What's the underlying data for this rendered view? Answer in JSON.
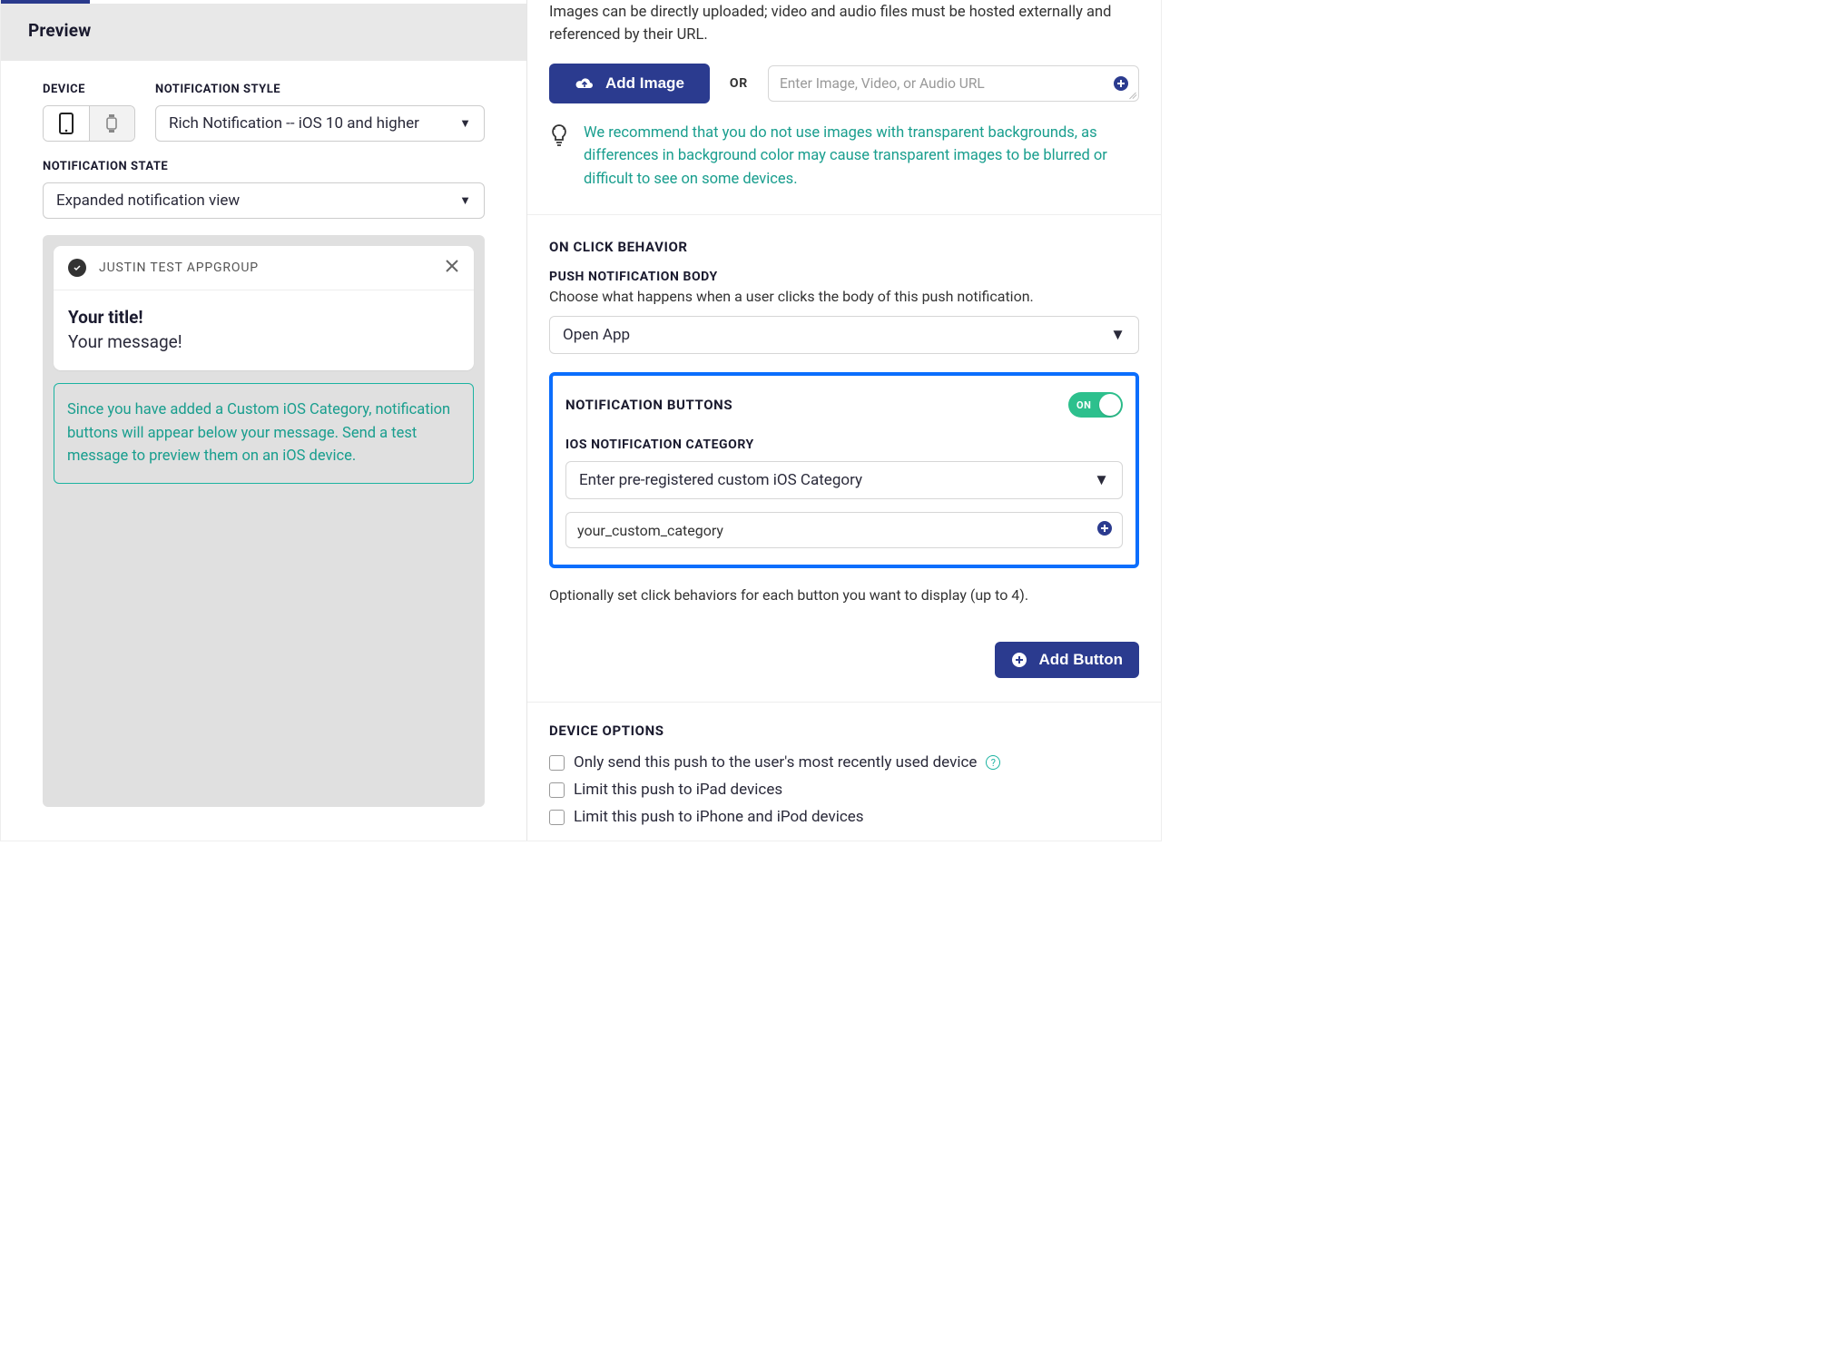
{
  "preview": {
    "header": "Preview",
    "device_label": "DEVICE",
    "style_label": "NOTIFICATION STYLE",
    "style_value": "Rich Notification -- iOS 10 and higher",
    "state_label": "NOTIFICATION STATE",
    "state_value": "Expanded notification view",
    "app_name": "JUSTIN TEST APPGROUP",
    "notif_title": "Your title!",
    "notif_msg": "Your message!",
    "info_msg": "Since you have added a Custom iOS Category, notification buttons will appear below your message. Send a test message to preview them on an iOS device."
  },
  "media": {
    "desc": "Images can be directly uploaded; video and audio files must be hosted externally and referenced by their URL.",
    "add_image_label": "Add Image",
    "or_label": "OR",
    "url_placeholder": "Enter Image, Video, or Audio URL",
    "tip": "We recommend that you do not use images with transparent backgrounds, as differences in background color may cause transparent images to be blurred or difficult to see on some devices."
  },
  "onclick": {
    "section_title": "ON CLICK BEHAVIOR",
    "body_label": "PUSH NOTIFICATION BODY",
    "body_desc": "Choose what happens when a user clicks the body of this push notification.",
    "body_select": "Open App"
  },
  "buttons": {
    "section_title": "NOTIFICATION BUTTONS",
    "toggle_label": "ON",
    "category_label": "IOS NOTIFICATION CATEGORY",
    "category_select": "Enter pre-registered custom iOS Category",
    "category_value": "your_custom_category",
    "opt_desc": "Optionally set click behaviors for each button you want to display (up to 4).",
    "add_button_label": "Add Button"
  },
  "device_options": {
    "section_title": "DEVICE OPTIONS",
    "opt1": "Only send this push to the user's most recently used device",
    "opt2": "Limit this push to iPad devices",
    "opt3": "Limit this push to iPhone and iPod devices"
  }
}
